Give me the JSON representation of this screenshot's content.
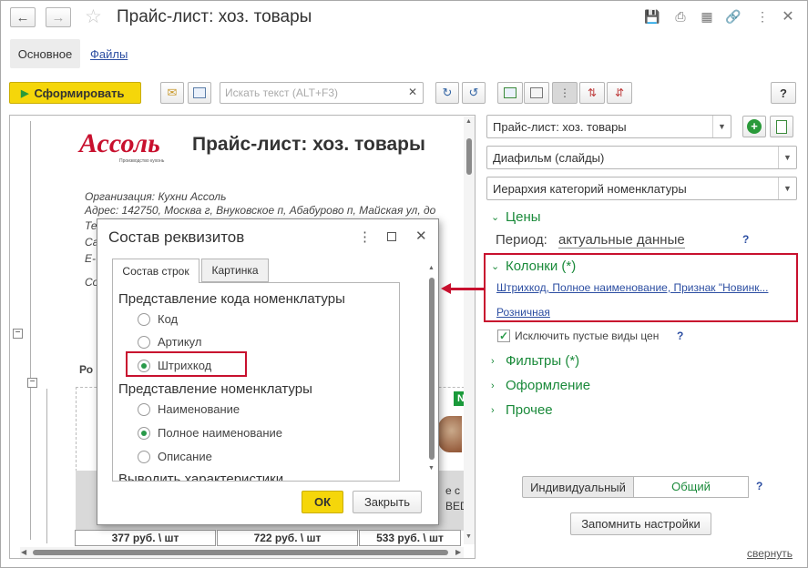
{
  "window": {
    "title": "Прайс-лист: хоз. товары"
  },
  "tabs": [
    {
      "label": "Основное"
    },
    {
      "label": "Файлы"
    }
  ],
  "toolbar": {
    "generate_label": "Сформировать",
    "search_placeholder": "Искать текст (ALT+F3)",
    "help_label": "?"
  },
  "report": {
    "logo_text": "Ассоль",
    "logo_subtext": "Производство кухонь",
    "title": "Прайс-лист: хоз. товары",
    "org_line": "Организация: Кухни Ассоль",
    "address_line": "Адрес: 142750, Москва г, Внуковское п, Абабурово п, Майская ул, до",
    "line_te": "Те",
    "line_sa": "Са",
    "line_e": "E-",
    "line_so": "Со",
    "line_ro": "Ро",
    "badge": "N",
    "side_text_1": "е с",
    "side_text_2": "BED",
    "prices": [
      "377 руб. \\ шт",
      "722 руб. \\ шт",
      "533 руб. \\ шт"
    ]
  },
  "dialog": {
    "title": "Состав реквизитов",
    "tabs": [
      {
        "label": "Состав строк"
      },
      {
        "label": "Картинка"
      }
    ],
    "group1_title": "Представление кода номенклатуры",
    "group1_options": [
      {
        "label": "Код"
      },
      {
        "label": "Артикул"
      },
      {
        "label": "Штрихкод"
      }
    ],
    "group2_title": "Представление номенклатуры",
    "group2_options": [
      {
        "label": "Наименование"
      },
      {
        "label": "Полное наименование"
      },
      {
        "label": "Описание"
      }
    ],
    "group3_title": "Выводить характеристики",
    "ok_label": "ОК",
    "close_label": "Закрыть"
  },
  "settings": {
    "variant_select": "Прайс-лист: хоз. товары",
    "view_select": "Диафильм (слайды)",
    "hierarchy_select": "Иерархия категорий номенклатуры",
    "prices_section": "Цены",
    "period_label": "Период:",
    "period_value": "актуальные данные",
    "columns_section": "Колонки (*)",
    "columns_link": "Штрихкод, Полное наименование, Признак \"Новинк...",
    "retail_link": "Розничная",
    "exclude_empty_label": "Исключить пустые виды цен",
    "filters_section": "Фильтры (*)",
    "design_section": "Оформление",
    "other_section": "Прочее",
    "individual_label": "Индивидуальный",
    "common_label": "Общий",
    "remember_label": "Запомнить настройки",
    "collapse_link": "свернуть",
    "help_q": "?"
  },
  "colors": {
    "accent_green": "#1a8a3a",
    "highlight_red": "#c8102e",
    "primary_yellow": "#f5d60a",
    "link_blue": "#2c4ea2"
  }
}
